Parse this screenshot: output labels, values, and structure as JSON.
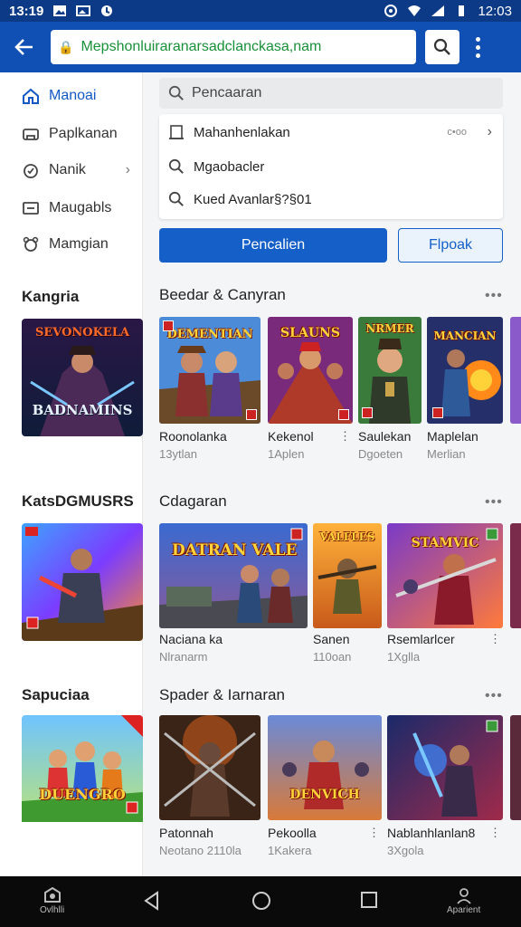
{
  "status_bar": {
    "time_left": "13:19",
    "time_right": "12:03"
  },
  "app_bar": {
    "url": "Mepshonluiraranarsadclanckasa,nam"
  },
  "sidebar": {
    "nav": [
      {
        "label": "Manoai",
        "icon": "home-icon",
        "active": true
      },
      {
        "label": "Paplkanan",
        "icon": "apps-icon",
        "active": false
      },
      {
        "label": "Nanik",
        "icon": "game-icon",
        "active": false,
        "has_chevron": true
      },
      {
        "label": "Maugabls",
        "icon": "device-icon",
        "active": false
      },
      {
        "label": "Mamgian",
        "icon": "mascot-icon",
        "active": false
      }
    ],
    "categories": [
      {
        "title": "Kangria",
        "art_label": "BADNAMINS",
        "art_top": "SEVONOKELA"
      },
      {
        "title": "KatsDGMUSRS"
      },
      {
        "title": "Sapuciaa",
        "art_label": "DUENGRO"
      }
    ]
  },
  "main": {
    "search_placeholder": "Pencaaran",
    "suggestions": [
      {
        "text": "Mahanhenlakan",
        "icon": "history-icon",
        "meta": "c•oo"
      },
      {
        "text": "Mgaobacler",
        "icon": "search-icon"
      },
      {
        "text": "Kued Avanlar§?§01",
        "icon": "search-icon"
      }
    ],
    "primary_button": "Pencalien",
    "secondary_button": "Flpoak",
    "sections": [
      {
        "title": "Beedar & Canyran",
        "more": "•••",
        "items": [
          {
            "name": "Roonolanka",
            "sub": "13ytlan",
            "art": "DEMENTIAN"
          },
          {
            "name": "Kekenol",
            "sub": "1Aplen",
            "art": "SLAUNS"
          },
          {
            "name": "Saulekan",
            "sub": "Dgoeten",
            "art": "NRMER"
          },
          {
            "name": "Maplelan",
            "sub": "Merlian",
            "art": "MANCIAN"
          }
        ]
      },
      {
        "title": "Cdagaran",
        "more": "•••",
        "items": [
          {
            "name": "Naciana ka",
            "sub": "Nlranarm",
            "art": "DATRAN VALE"
          },
          {
            "name": "Sanen",
            "sub": "110oan",
            "art": "VALFLES"
          },
          {
            "name": "Rsemlarlcer",
            "sub": "1Xglla",
            "art": "STAMVIC"
          }
        ]
      },
      {
        "title": "Spader & Iarnaran",
        "more": "•••",
        "items": [
          {
            "name": "Patonnah",
            "sub": "Neotano 2110la",
            "art": ""
          },
          {
            "name": "Pekoolla",
            "sub": "1Kakera",
            "art": "DENVICH"
          },
          {
            "name": "Nablanhlanlan8",
            "sub": "3Xgola",
            "art": ""
          }
        ]
      }
    ]
  },
  "bottom_nav": {
    "left_label": "Ovlhlli",
    "right_label": "Aparient"
  }
}
